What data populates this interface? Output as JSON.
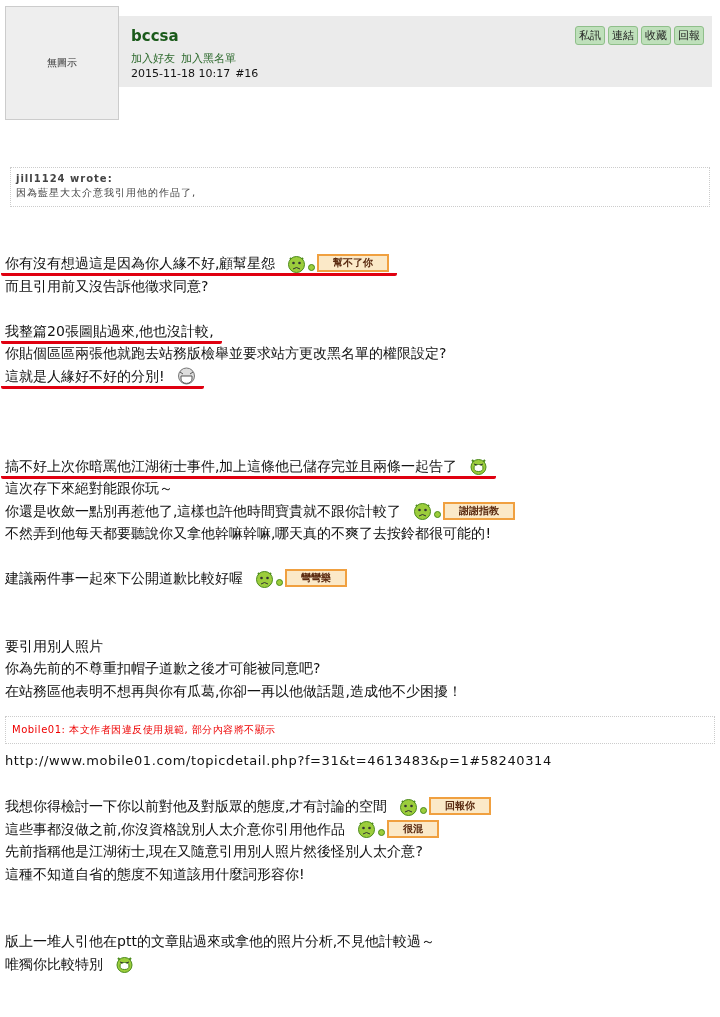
{
  "post": {
    "avatar_text": "無圖示",
    "username": "bccsa",
    "links": [
      "加入好友",
      "加入黑名單"
    ],
    "timestamp": "2015-11-18 10:17",
    "post_number": "#16",
    "actions": [
      "私訊",
      "連結",
      "收藏",
      "回報"
    ]
  },
  "quote": {
    "author": "jill1124 wrote:",
    "text": "因為藍星大太介意我引用他的作品了,"
  },
  "body": [
    {
      "kind": "gap"
    },
    {
      "kind": "gap"
    },
    {
      "kind": "line",
      "text": "你有沒有想過這是因為你人緣不好,顧幫星怨",
      "underlined": true,
      "emoticon": {
        "kind": "sign",
        "sign": "幫不了你"
      }
    },
    {
      "kind": "line",
      "text": "而且引用前又沒告訴他徵求同意?",
      "underlined": false
    },
    {
      "kind": "gap"
    },
    {
      "kind": "line",
      "text": "我整篇20張圖貼過來,他也沒計較,",
      "underlined": true
    },
    {
      "kind": "line",
      "text": "你貼個區區兩張他就跑去站務版檢舉並要求站方更改黑名單的權限設定?",
      "underlined": false
    },
    {
      "kind": "line",
      "text": "這就是人緣好不好的分別!",
      "underlined": true,
      "emoticon": {
        "kind": "grin"
      }
    },
    {
      "kind": "gap"
    },
    {
      "kind": "gap"
    },
    {
      "kind": "gap"
    },
    {
      "kind": "line",
      "text": "搞不好上次你暗罵他江湖術士事件,加上這條他已儲存完並且兩條一起告了",
      "underlined": true,
      "emoticon": {
        "kind": "laugh"
      }
    },
    {
      "kind": "line",
      "text": "這次存下來絕對能跟你玩～",
      "underlined": false
    },
    {
      "kind": "line",
      "text": "你還是收斂一點別再惹他了,這樣也許他時間寶貴就不跟你計較了",
      "underlined": false,
      "emoticon": {
        "kind": "sign",
        "sign": "謝謝指教"
      }
    },
    {
      "kind": "line",
      "text": "不然弄到他每天都要聽說你又拿他幹嘛幹嘛,哪天真的不爽了去按鈴都很可能的!",
      "underlined": false
    },
    {
      "kind": "gap"
    },
    {
      "kind": "line",
      "text": "建議兩件事一起來下公開道歉比較好喔",
      "underlined": false,
      "emoticon": {
        "kind": "sign",
        "sign": "彎彎樂"
      }
    },
    {
      "kind": "gap"
    },
    {
      "kind": "gap"
    },
    {
      "kind": "line",
      "text": "要引用別人照片",
      "underlined": false
    },
    {
      "kind": "line",
      "text": "你為先前的不尊重扣帽子道歉之後才可能被同意吧?",
      "underlined": false
    },
    {
      "kind": "line",
      "text": "在站務區他表明不想再與你有瓜葛,你卻一再以他做話題,造成他不少困擾！",
      "underlined": false
    },
    {
      "kind": "notice",
      "text": "Mobile01: 本文作者因違反使用規範, 部分內容將不顯示"
    },
    {
      "kind": "url",
      "text": "http://www.mobile01.com/topicdetail.php?f=31&t=4613483&p=1#58240314"
    },
    {
      "kind": "gap"
    },
    {
      "kind": "line",
      "text": "我想你得檢討一下你以前對他及對版眾的態度,才有討論的空間",
      "underlined": false,
      "emoticon": {
        "kind": "sign",
        "sign": "回報你"
      }
    },
    {
      "kind": "line",
      "text": "這些事都沒做之前,你沒資格說別人太介意你引用他作品",
      "underlined": false,
      "emoticon": {
        "kind": "sign",
        "sign": "很混"
      }
    },
    {
      "kind": "line",
      "text": "先前指稱他是江湖術士,現在又隨意引用別人照片然後怪別人太介意?",
      "underlined": false
    },
    {
      "kind": "line",
      "text": "這種不知道自省的態度不知道該用什麼詞形容你!",
      "underlined": false
    },
    {
      "kind": "gap"
    },
    {
      "kind": "gap"
    },
    {
      "kind": "line",
      "text": "版上一堆人引他在ptt的文章貼過來或拿他的照片分析,不見他計較過～",
      "underlined": false
    },
    {
      "kind": "line",
      "text": "唯獨你比較特別",
      "underlined": false,
      "emoticon": {
        "kind": "laugh"
      }
    }
  ]
}
